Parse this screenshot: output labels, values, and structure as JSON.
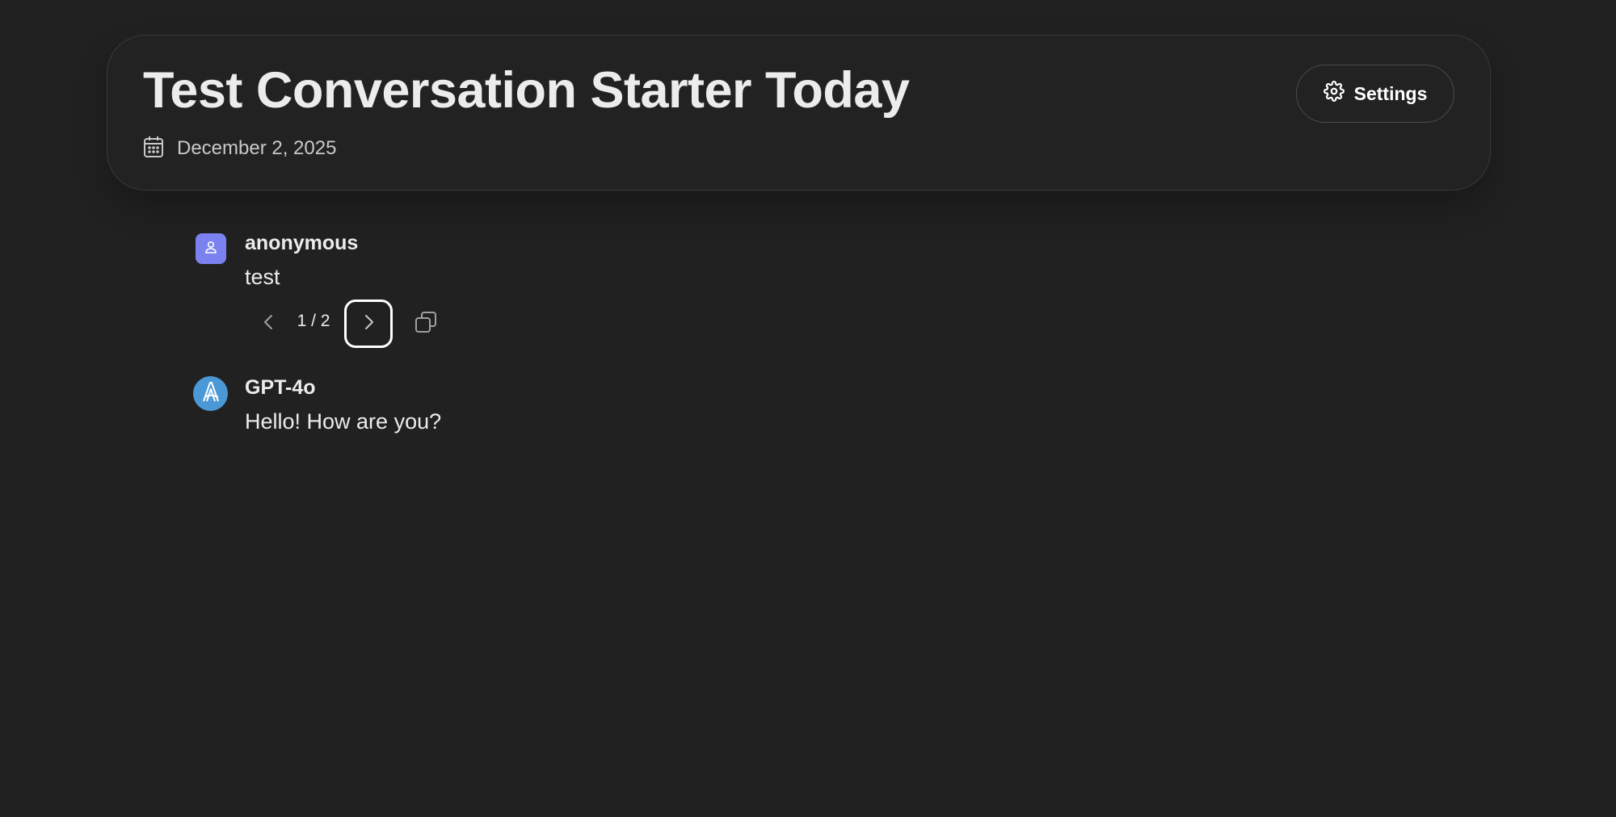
{
  "header": {
    "title": "Test Conversation Starter Today",
    "date": "December 2, 2025",
    "settings_label": "Settings"
  },
  "messages": [
    {
      "author": "anonymous",
      "text": "test",
      "avatar_icon": "user-icon",
      "avatar_color": "#7b82f0",
      "controls": {
        "page_indicator": "1 / 2",
        "prev_icon": "chevron-left-icon",
        "next_icon": "chevron-right-icon",
        "copy_icon": "copy-icon"
      }
    },
    {
      "author": "GPT-4o",
      "text": "Hello! How are you?",
      "avatar_icon": "model-logo-icon",
      "avatar_color": "#4a98d6"
    }
  ],
  "colors": {
    "background": "#212121",
    "text": "#ececec",
    "border": "#3a3a3a"
  }
}
